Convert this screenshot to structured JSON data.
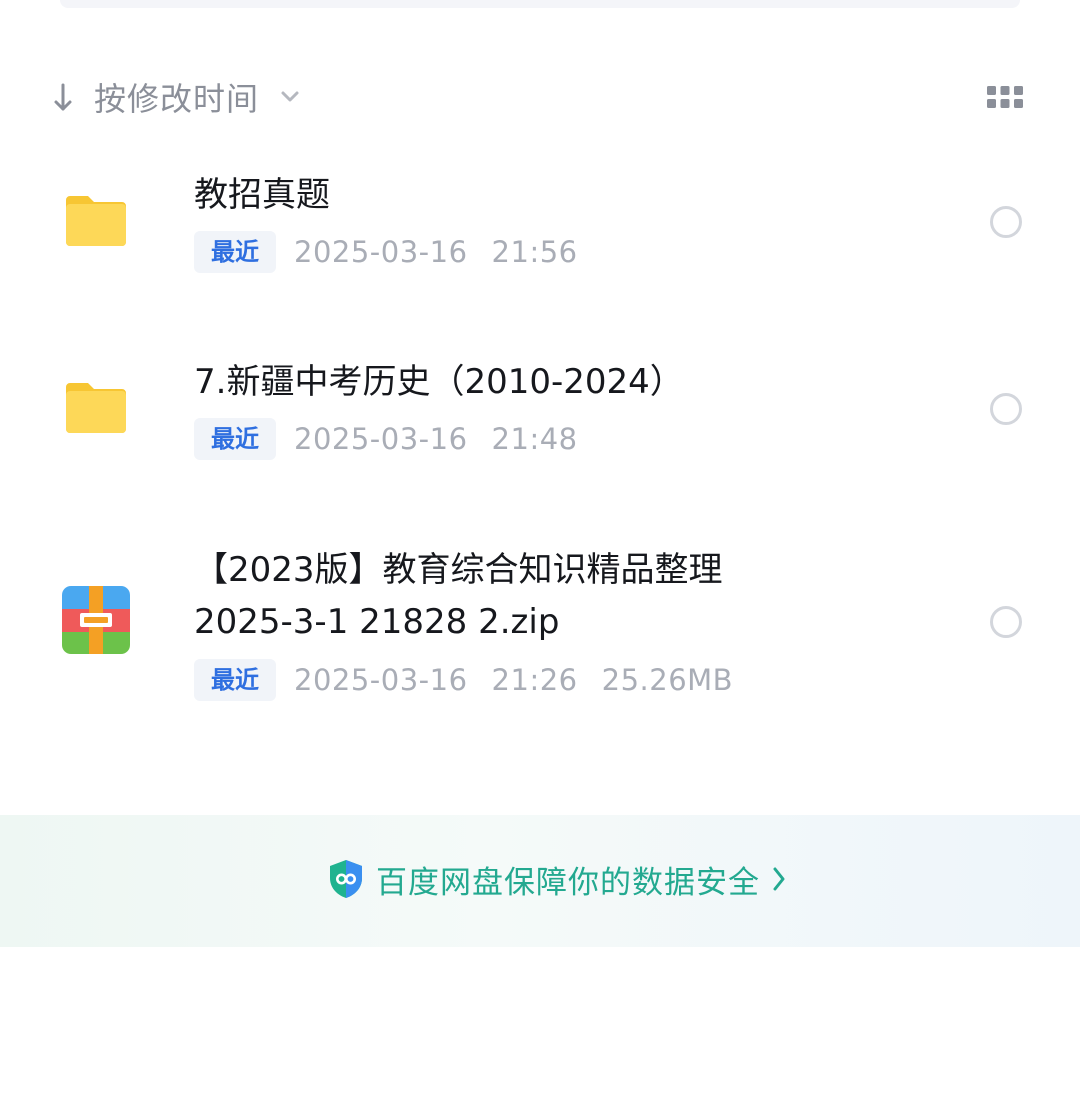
{
  "sort": {
    "label": "按修改时间",
    "direction_icon": "arrow-down-icon",
    "dropdown_icon": "chevron-down-icon"
  },
  "view_toggle_icon": "grid-icon",
  "files": [
    {
      "type": "folder",
      "icon": "folder-icon",
      "name": "教招真题",
      "badge": "最近",
      "date": "2025-03-16",
      "time": "21:56",
      "size": ""
    },
    {
      "type": "folder",
      "icon": "folder-icon",
      "name": "7.新疆中考历史（2010-2024）",
      "badge": "最近",
      "date": "2025-03-16",
      "time": "21:48",
      "size": ""
    },
    {
      "type": "archive",
      "icon": "zip-archive-icon",
      "name": "【2023版】教育综合知识精品整理\n2025-3-1 21828 2.zip",
      "badge": "最近",
      "date": "2025-03-16",
      "time": "21:26",
      "size": "25.26MB"
    }
  ],
  "security_banner": {
    "text": "百度网盘保障你的数据安全",
    "icon": "shield-icon",
    "arrow_icon": "chevron-right-icon"
  },
  "colors": {
    "folder": "#fbd34a",
    "badge_text": "#2f6fe0",
    "badge_bg": "#f1f4f9",
    "security_text": "#23a990",
    "meta_text": "#a9adb6",
    "primary_text": "#16181d"
  }
}
